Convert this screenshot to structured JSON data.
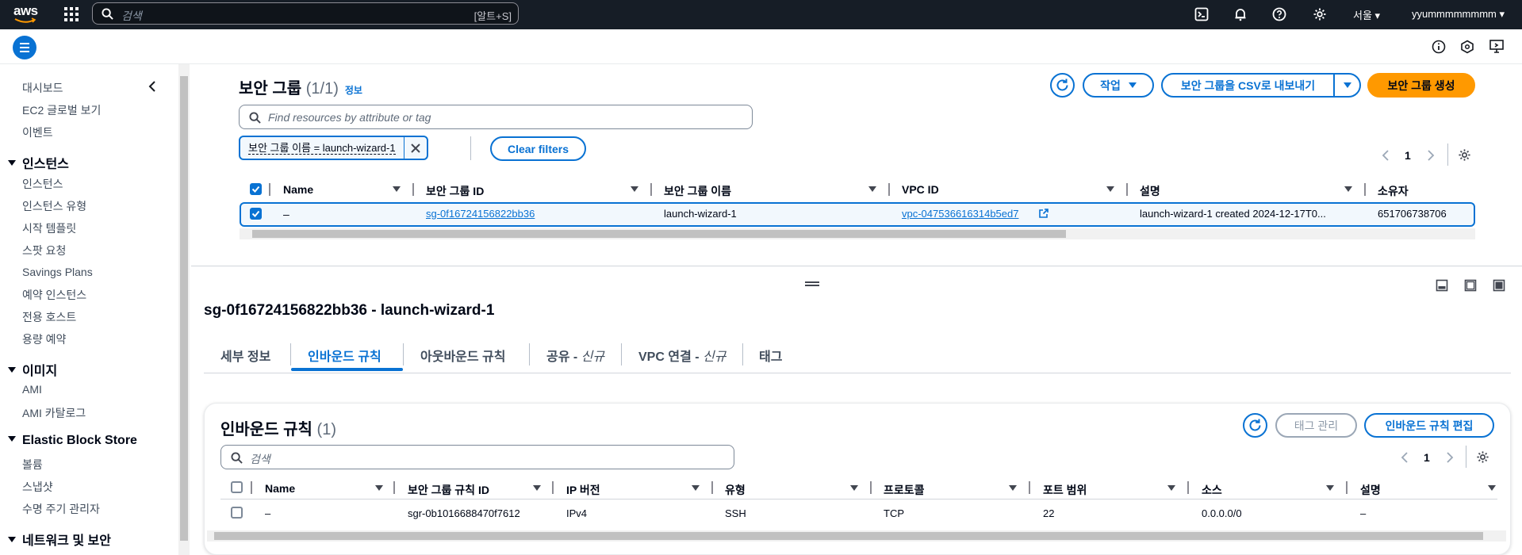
{
  "topnav": {
    "logo_text": "aws",
    "search_placeholder": "검색",
    "search_shortcut": "[알트+S]",
    "region": "서울 ▾",
    "user": "yyummmmmmmm ▾"
  },
  "sidebar": {
    "items_top": [
      "대시보드",
      "EC2 글로벌 보기",
      "이벤트"
    ],
    "sections": [
      {
        "title": "인스턴스",
        "items": [
          "인스턴스",
          "인스턴스 유형",
          "시작 템플릿",
          "스팟 요청",
          "Savings Plans",
          "예약 인스턴스",
          "전용 호스트",
          "용량 예약"
        ]
      },
      {
        "title": "이미지",
        "items": [
          "AMI",
          "AMI 카탈로그"
        ]
      },
      {
        "title": "Elastic Block Store",
        "items": [
          "볼륨",
          "스냅샷",
          "수명 주기 관리자"
        ]
      },
      {
        "title": "네트워크 및 보안",
        "items": []
      }
    ]
  },
  "sg_list": {
    "title": "보안 그룹",
    "count": "(1/1)",
    "info": "정보",
    "actions_label": "작업",
    "export_label": "보안 그룹을 CSV로 내보내기",
    "create_label": "보안 그룹 생성",
    "search_placeholder": "Find resources by attribute or tag",
    "filter_token": "보안 그룹 이름 = launch-wizard-1",
    "clear_filters": "Clear filters",
    "page": "1",
    "columns": [
      "Name",
      "보안 그룹 ID",
      "보안 그룹 이름",
      "VPC ID",
      "설명",
      "소유자"
    ],
    "row": {
      "name": "–",
      "sg_id": "sg-0f16724156822bb36",
      "sg_name": "launch-wizard-1",
      "vpc_id": "vpc-047536616314b5ed7",
      "description": "launch-wizard-1 created 2024-12-17T0...",
      "owner": "651706738706"
    }
  },
  "detail": {
    "title": "sg-0f16724156822bb36 - launch-wizard-1",
    "tabs": [
      {
        "label": "세부 정보",
        "suffix": ""
      },
      {
        "label": "인바운드 규칙",
        "suffix": ""
      },
      {
        "label": "아웃바운드 규칙",
        "suffix": ""
      },
      {
        "label": "공유 - ",
        "suffix": "신규"
      },
      {
        "label": "VPC 연결 - ",
        "suffix": "신규"
      },
      {
        "label": "태그",
        "suffix": ""
      }
    ]
  },
  "inbound": {
    "title": "인바운드 규칙",
    "count": "(1)",
    "manage_tags": "태그 관리",
    "edit_label": "인바운드 규칙 편집",
    "search_placeholder": "검색",
    "page": "1",
    "columns": [
      "Name",
      "보안 그룹 규칙 ID",
      "IP 버전",
      "유형",
      "프로토콜",
      "포트 범위",
      "소스",
      "설명"
    ],
    "row": {
      "name": "–",
      "rule_id": "sgr-0b1016688470f7612",
      "ip_version": "IPv4",
      "type": "SSH",
      "protocol": "TCP",
      "port_range": "22",
      "source": "0.0.0.0/0",
      "description": "–"
    }
  }
}
